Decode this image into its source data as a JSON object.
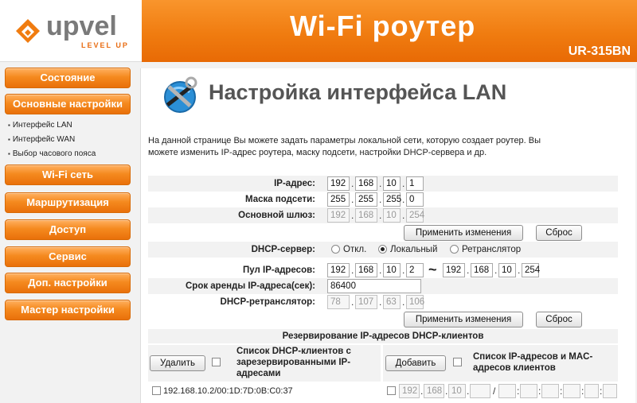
{
  "brand": {
    "logo": "upvel",
    "tagline": "LEVEL UP",
    "title": "Wi-Fi роутер",
    "model": "UR-315BN"
  },
  "sidebar": {
    "items": [
      {
        "label": "Состояние"
      },
      {
        "label": "Основные настройки"
      },
      {
        "label": "Wi-Fi сеть"
      },
      {
        "label": "Маршрутизация"
      },
      {
        "label": "Доступ"
      },
      {
        "label": "Сервис"
      },
      {
        "label": "Доп. настройки"
      },
      {
        "label": "Мастер настройки"
      }
    ],
    "subitems": [
      {
        "label": "Интерфейс LAN"
      },
      {
        "label": "Интерфейс WAN"
      },
      {
        "label": "Выбор часового пояса"
      }
    ]
  },
  "page": {
    "title": "Настройка интерфейса LAN",
    "description": "На данной странице Вы можете задать параметры локальной сети, которую создает роутер. Вы можете изменить IP-адрес роутера, маску подсети, настройки DHCP-сервера и др."
  },
  "lan": {
    "ip_label": "IP-адрес:",
    "ip": [
      "192",
      "168",
      "10",
      "1"
    ],
    "mask_label": "Маска подсети:",
    "mask": [
      "255",
      "255",
      "255",
      "0"
    ],
    "gateway_label": "Основной шлюз:",
    "gateway": [
      "192",
      "168",
      "10",
      "254"
    ],
    "apply_label": "Применить изменения",
    "reset_label": "Сброс"
  },
  "dhcp": {
    "server_label": "DHCP-сервер:",
    "mode_off": "Откл.",
    "mode_local": "Локальный",
    "mode_relay": "Ретранслятор",
    "pool_label": "Пул IP-адресов:",
    "pool_start": [
      "192",
      "168",
      "10",
      "2"
    ],
    "pool_end": [
      "192",
      "168",
      "10",
      "254"
    ],
    "lease_label": "Срок аренды IP-адреса(сек):",
    "lease": "86400",
    "relay_label": "DHCP-ретранслятор:",
    "relay": [
      "78",
      "107",
      "63",
      "106"
    ],
    "apply_label": "Применить изменения",
    "reset_label": "Сброс"
  },
  "reservation": {
    "header": "Резервирование IP-адресов DHCP-клиентов",
    "delete_label": "Удалить",
    "reserved_list_label": "Список DHCP-клиентов с зарезервированными IP-адресами",
    "add_label": "Добавить",
    "clients_list_label": "Список IP-адресов и MAC-адресов клиентов",
    "reserved_entry": "192.168.10.2/00:1D:7D:0B:C0:37",
    "new_ip": [
      "192",
      "168",
      "10",
      ""
    ]
  },
  "colors": {
    "accent": "#f07c10",
    "banner": "#f58a1f"
  }
}
